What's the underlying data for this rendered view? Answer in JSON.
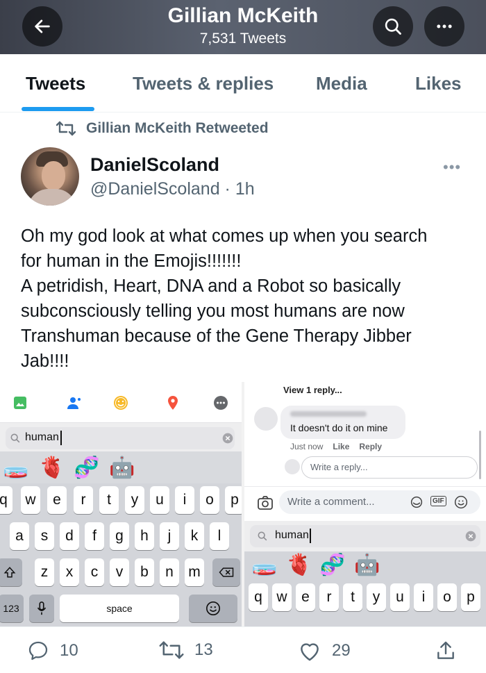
{
  "header": {
    "title": "Gillian McKeith",
    "subtitle": "7,531 Tweets"
  },
  "tabs": [
    {
      "label": "Tweets",
      "active": true
    },
    {
      "label": "Tweets & replies",
      "active": false
    },
    {
      "label": "Media",
      "active": false
    },
    {
      "label": "Likes",
      "active": false
    }
  ],
  "tweet": {
    "retweet_label": "Gillian McKeith Retweeted",
    "author_name": "DanielScoland",
    "author_handle": "@DanielScoland · 1h",
    "text_lines": [
      "Oh my god look at what comes up when you search",
      "for human in the Emojis!!!!!!!",
      "A petridish, Heart, DNA and a Robot so basically",
      "subconsciously telling you most humans are now",
      "Transhuman because of the Gene Therapy Jibber",
      "Jab!!!!"
    ],
    "more_glyph": "•••"
  },
  "media": {
    "left": {
      "search_text": "human",
      "emojis": [
        "🧫",
        "🫀",
        "🧬",
        "🤖"
      ],
      "row1": [
        "q",
        "w",
        "e",
        "r",
        "t",
        "y",
        "u",
        "i",
        "o",
        "p"
      ],
      "row2": [
        "a",
        "s",
        "d",
        "f",
        "g",
        "h",
        "j",
        "k",
        "l"
      ],
      "row3": [
        "z",
        "x",
        "c",
        "v",
        "b",
        "n",
        "m"
      ],
      "num_key": "123",
      "space_key": "space"
    },
    "right": {
      "view_replies": "View 1 reply...",
      "comment_text": "It doesn't do it on mine",
      "comment_time": "Just now",
      "like_label": "Like",
      "reply_label": "Reply",
      "reply_placeholder": "Write a reply...",
      "comment_placeholder": "Write a comment...",
      "gif_label": "GIF",
      "search_text": "human",
      "emojis": [
        "🧫",
        "🫀",
        "🧬",
        "🤖"
      ],
      "row1": [
        "q",
        "w",
        "e",
        "r",
        "t",
        "y",
        "u",
        "i",
        "o",
        "p"
      ]
    }
  },
  "actions": {
    "replies": "10",
    "retweets": "13",
    "likes": "29"
  },
  "colors": {
    "accent": "#1d9bf0",
    "secondary_text": "#536471"
  }
}
